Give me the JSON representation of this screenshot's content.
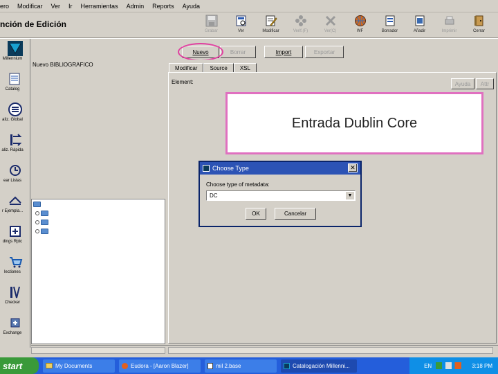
{
  "menu": [
    "ero",
    "Modificar",
    "Ver",
    "Ir",
    "Herramientas",
    "Admin",
    "Reports",
    "Ayuda"
  ],
  "title": "nción de Edición",
  "toolbar": [
    {
      "label": "Grabar",
      "icon": "save-icon",
      "enabled": false
    },
    {
      "label": "Ver",
      "icon": "view-icon",
      "enabled": true
    },
    {
      "label": "Modificar",
      "icon": "edit-icon",
      "enabled": true
    },
    {
      "label": "Verif.(F)",
      "icon": "validate-icon",
      "enabled": false
    },
    {
      "label": "Ver(C)",
      "icon": "tool-icon",
      "enabled": false
    },
    {
      "label": "WF",
      "icon": "workflow-icon",
      "enabled": true
    },
    {
      "label": "Borrador",
      "icon": "draft-icon",
      "enabled": true
    },
    {
      "label": "Añadir",
      "icon": "add-icon",
      "enabled": true
    },
    {
      "label": "Imprimir",
      "icon": "print-icon",
      "enabled": false
    },
    {
      "label": "Cerrar",
      "icon": "close-door-icon",
      "enabled": true
    }
  ],
  "sidebar": [
    {
      "label": "Millennium",
      "icon": "millennium-logo-icon"
    },
    {
      "label": "Catalog",
      "icon": "catalog-icon"
    },
    {
      "label": "aliz. Global",
      "icon": "global-update-icon"
    },
    {
      "label": "aliz. Rápida",
      "icon": "rapid-update-icon"
    },
    {
      "label": "ear Listas",
      "icon": "create-lists-icon"
    },
    {
      "label": "r Ejempla...",
      "icon": "items-icon"
    },
    {
      "label": "dings Rptc",
      "icon": "holdings-icon"
    },
    {
      "label": "lectiones",
      "icon": "selection-icon"
    },
    {
      "label": "Checker",
      "icon": "checker-icon"
    },
    {
      "label": "Exchange",
      "icon": "exchange-icon"
    }
  ],
  "actions": {
    "nuevo": "Nuevo",
    "borrar": "Borrar",
    "import": "Import",
    "exportar": "Exportar"
  },
  "left_panel": {
    "title": "Nuevo BIBLIOGRAFICO"
  },
  "tabs": [
    "Modificar",
    "Source",
    "XSL"
  ],
  "element_label": "Element:",
  "editor_buttons": {
    "ayuda": "Ayuda",
    "attr": "Attr"
  },
  "callout": "Entrada Dublin Core",
  "dialog": {
    "title": "Choose Type",
    "label": "Choose type of metadata:",
    "selected": "DC",
    "ok": "OK",
    "cancel": "Cancelar"
  },
  "taskbar": {
    "start": "start",
    "tasks": [
      {
        "label": "My Documents",
        "active": false
      },
      {
        "label": "Eudora - [Aaron Blazer]",
        "active": false
      },
      {
        "label": "mil 2.base",
        "active": false
      },
      {
        "label": "Catalogación Millenni...",
        "active": true
      }
    ],
    "lang": "EN",
    "time": "3:18 PM"
  }
}
